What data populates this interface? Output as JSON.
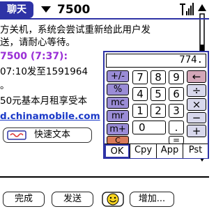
{
  "titlebar": {
    "tab_label": "聊天",
    "contact": "7500"
  },
  "messages": {
    "line1": "方关机，系统会尝试重新给此用户发",
    "line2": "送，请耐心等待。",
    "header": "7500 (7:37):",
    "line3": "07:10发至1591964",
    "line4": "。",
    "line5": "50元基本月租享受本",
    "link": "d.chinamobile.com"
  },
  "quick_text_label": "快速文本",
  "calculator": {
    "display": "774.",
    "keys": {
      "pm": "+/-",
      "pct": "%",
      "mc": "mc",
      "mr": "mr",
      "mplus": "m+",
      "c": "C",
      "k7": "7",
      "k8": "8",
      "k9": "9",
      "k4": "4",
      "k5": "5",
      "k6": "6",
      "k1": "1",
      "k2": "2",
      "k3": "3",
      "k0": "0",
      "dot": ".",
      "eq": "=",
      "back": "←",
      "div": "÷",
      "mul": "×",
      "minus": "−",
      "plus": "+"
    },
    "tabs": {
      "ok": "OK",
      "cpy": "Cpy",
      "app": "App",
      "pst": "Pst"
    }
  },
  "bottom": {
    "done": "完成",
    "send": "发送",
    "more": "增加..."
  }
}
